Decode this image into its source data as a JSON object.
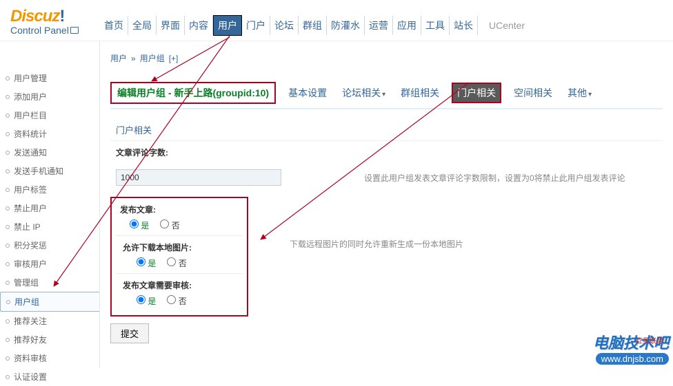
{
  "logo": {
    "brand": "Discuz",
    "bang": "!",
    "sub": "Control Panel"
  },
  "nav": [
    "首页",
    "全局",
    "界面",
    "内容",
    "用户",
    "门户",
    "论坛",
    "群组",
    "防灌水",
    "运营",
    "应用",
    "工具",
    "站长"
  ],
  "nav_active_index": 4,
  "nav_extra": "UCenter",
  "sidebar": [
    "用户管理",
    "添加用户",
    "用户栏目",
    "资料统计",
    "发送通知",
    "发送手机通知",
    "用户标签",
    "禁止用户",
    "禁止 IP",
    "积分奖惩",
    "审核用户",
    "管理组",
    "用户组",
    "推荐关注",
    "推荐好友",
    "资料审核",
    "认证设置"
  ],
  "sidebar_active_index": 12,
  "breadcrumb": {
    "a": "用户",
    "sep": "»",
    "b": "用户组",
    "plus": "[+]"
  },
  "tabs": {
    "edit": "编辑用户组 - 新手上路(groupid:10)",
    "items": [
      "基本设置",
      "论坛相关",
      "群组相关",
      "门户相关",
      "空间相关",
      "其他"
    ],
    "active_index": 3,
    "caret_indexes": [
      1,
      5
    ]
  },
  "section_title": "门户相关",
  "field_comment": {
    "label": "文章评论字数:",
    "value": "1000",
    "help": "设置此用户组发表文章评论字数限制，设置为0将禁止此用户组发表评论"
  },
  "opt_publish": {
    "label": "发布文章:",
    "yes": "是",
    "no": "否"
  },
  "opt_download": {
    "label": "允许下载本地图片:",
    "yes": "是",
    "no": "否",
    "help": "下载远程图片的同时允许重新生成一份本地图片"
  },
  "opt_review": {
    "label": "发布文章需要审核:",
    "yes": "是",
    "no": "否"
  },
  "submit": "提交",
  "watermark": {
    "top": "电脑技术吧",
    "bot": "www.dnjsb.com",
    "small": "红黑联盟"
  }
}
